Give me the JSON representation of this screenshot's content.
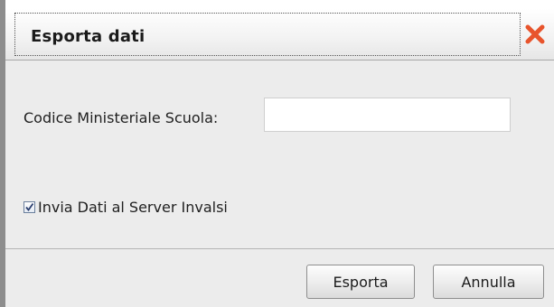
{
  "dialog": {
    "title": "Esporta dati",
    "close_icon": "close-icon",
    "close_color": "#e8542c"
  },
  "form": {
    "school_code_label": "Codice Ministeriale Scuola:",
    "school_code_value": "",
    "send_invalsi_label": "Invia Dati al Server Invalsi",
    "send_invalsi_checked": true
  },
  "buttons": {
    "export_label": "Esporta",
    "cancel_label": "Annulla"
  }
}
